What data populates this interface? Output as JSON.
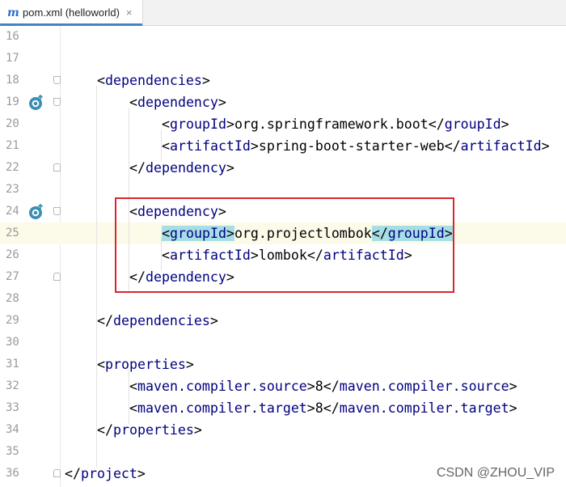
{
  "tab": {
    "title": "pom.xml (helloworld)",
    "close": "×",
    "icon": "m"
  },
  "lines": [
    {
      "n": "16",
      "indent": 0,
      "parts": []
    },
    {
      "n": "17",
      "indent": 0,
      "parts": []
    },
    {
      "n": "18",
      "indent": 1,
      "parts": [
        {
          "t": "<"
        },
        {
          "g": "dependencies"
        },
        {
          "t": ">"
        }
      ]
    },
    {
      "n": "19",
      "indent": 2,
      "parts": [
        {
          "t": "<"
        },
        {
          "g": "dependency"
        },
        {
          "t": ">"
        }
      ]
    },
    {
      "n": "20",
      "indent": 3,
      "parts": [
        {
          "t": "<"
        },
        {
          "g": "groupId"
        },
        {
          "t": ">"
        },
        {
          "v": "org.springframework.boot"
        },
        {
          "t": "</"
        },
        {
          "g": "groupId"
        },
        {
          "t": ">"
        }
      ]
    },
    {
      "n": "21",
      "indent": 3,
      "parts": [
        {
          "t": "<"
        },
        {
          "g": "artifactId"
        },
        {
          "t": ">"
        },
        {
          "v": "spring-boot-starter-web"
        },
        {
          "t": "</"
        },
        {
          "g": "artifactId"
        },
        {
          "t": ">"
        }
      ]
    },
    {
      "n": "22",
      "indent": 2,
      "parts": [
        {
          "t": "</"
        },
        {
          "g": "dependency"
        },
        {
          "t": ">"
        }
      ]
    },
    {
      "n": "23",
      "indent": 0,
      "parts": []
    },
    {
      "n": "24",
      "indent": 2,
      "parts": [
        {
          "t": "<"
        },
        {
          "g": "dependency"
        },
        {
          "t": ">"
        }
      ]
    },
    {
      "n": "25",
      "indent": 3,
      "parts": [
        {
          "t": "<",
          "h": 1
        },
        {
          "g": "groupId",
          "h": 1
        },
        {
          "t": ">",
          "h": 1
        },
        {
          "v": "org.projectlombok"
        },
        {
          "t": "</",
          "h": 1
        },
        {
          "g": "groupId",
          "h": 1
        },
        {
          "t": ">",
          "h": 1
        }
      ]
    },
    {
      "n": "26",
      "indent": 3,
      "parts": [
        {
          "t": "<"
        },
        {
          "g": "artifactId"
        },
        {
          "t": ">"
        },
        {
          "v": "lombok"
        },
        {
          "t": "</"
        },
        {
          "g": "artifactId"
        },
        {
          "t": ">"
        }
      ]
    },
    {
      "n": "27",
      "indent": 2,
      "parts": [
        {
          "t": "</"
        },
        {
          "g": "dependency"
        },
        {
          "t": ">"
        }
      ]
    },
    {
      "n": "28",
      "indent": 0,
      "parts": []
    },
    {
      "n": "29",
      "indent": 1,
      "parts": [
        {
          "t": "</"
        },
        {
          "g": "dependencies"
        },
        {
          "t": ">"
        }
      ]
    },
    {
      "n": "30",
      "indent": 0,
      "parts": []
    },
    {
      "n": "31",
      "indent": 1,
      "parts": [
        {
          "t": "<"
        },
        {
          "g": "properties"
        },
        {
          "t": ">"
        }
      ]
    },
    {
      "n": "32",
      "indent": 2,
      "parts": [
        {
          "t": "<"
        },
        {
          "g": "maven.compiler.source"
        },
        {
          "t": ">"
        },
        {
          "v": "8"
        },
        {
          "t": "</"
        },
        {
          "g": "maven.compiler.source"
        },
        {
          "t": ">"
        }
      ]
    },
    {
      "n": "33",
      "indent": 2,
      "parts": [
        {
          "t": "<"
        },
        {
          "g": "maven.compiler.target"
        },
        {
          "t": ">"
        },
        {
          "v": "8"
        },
        {
          "t": "</"
        },
        {
          "g": "maven.compiler.target"
        },
        {
          "t": ">"
        }
      ]
    },
    {
      "n": "34",
      "indent": 1,
      "parts": [
        {
          "t": "</"
        },
        {
          "g": "properties"
        },
        {
          "t": ">"
        }
      ]
    },
    {
      "n": "35",
      "indent": 0,
      "parts": []
    },
    {
      "n": "36",
      "indent": 0,
      "parts": [
        {
          "t": "</"
        },
        {
          "g": "project"
        },
        {
          "t": ">"
        }
      ]
    }
  ],
  "current_line": "25",
  "gutter_markers": [
    {
      "line": "19",
      "icon": "maven-override-icon"
    },
    {
      "line": "24",
      "icon": "maven-override-icon"
    }
  ],
  "fold_markers": [
    {
      "line": "18",
      "kind": "open"
    },
    {
      "line": "19",
      "kind": "open"
    },
    {
      "line": "22",
      "kind": "close"
    },
    {
      "line": "24",
      "kind": "open"
    },
    {
      "line": "27",
      "kind": "close"
    },
    {
      "line": "36",
      "kind": "close"
    }
  ],
  "highlight_box": {
    "from_line": "24",
    "to_line": "27",
    "color": "#d9262d"
  },
  "watermark": "CSDN @ZHOU_VIP"
}
